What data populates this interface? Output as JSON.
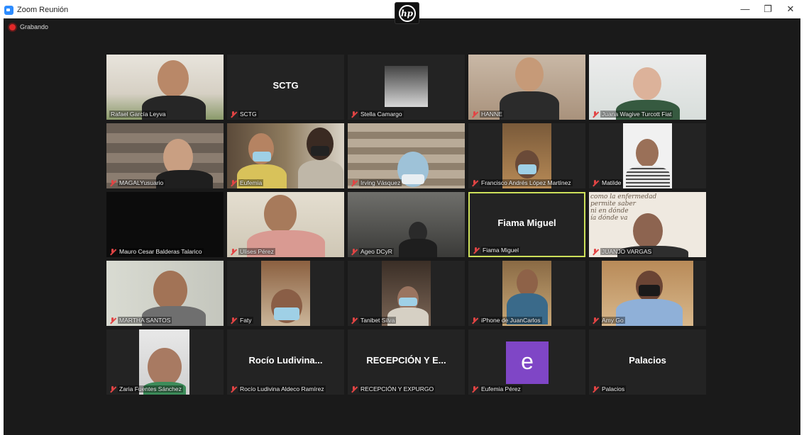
{
  "window": {
    "title": "Zoom Reunión",
    "controls": {
      "minimize": "—",
      "maximize": "❐",
      "close": "✕"
    }
  },
  "meeting": {
    "recording_label": "Grabando",
    "colors": {
      "background": "#1a1a1a",
      "tile": "#232323",
      "active_border": "#cde05a",
      "muted_mic": "#e24444",
      "avatar_purple": "#7f46c6"
    }
  },
  "participants": [
    {
      "name": "Rafael García Leyva",
      "center": ""
    },
    {
      "name": "SCTG",
      "center": "SCTG"
    },
    {
      "name": "Stella Camargo",
      "center": ""
    },
    {
      "name": "HANNE",
      "center": ""
    },
    {
      "name": "Juana Wagive Turcott Fiat",
      "center": ""
    },
    {
      "name": "MAGALYusuario",
      "center": ""
    },
    {
      "name": "Eufemia",
      "center": ""
    },
    {
      "name": "Irving Vásquez",
      "center": ""
    },
    {
      "name": "Francisco Andrés López Martínez",
      "center": ""
    },
    {
      "name": "Matilde",
      "center": ""
    },
    {
      "name": "Mauro Cesar Balderas Talarico",
      "center": ""
    },
    {
      "name": "Ulises Pérez",
      "center": ""
    },
    {
      "name": "Ageo DCyR",
      "center": ""
    },
    {
      "name": "Fiama Miguel",
      "center": "Fiama Miguel"
    },
    {
      "name": "JUANJO VARGAS",
      "center": ""
    },
    {
      "name": "MARTHA SANTOS",
      "center": ""
    },
    {
      "name": "Faty",
      "center": ""
    },
    {
      "name": "Tanibet Silva",
      "center": ""
    },
    {
      "name": "iPhone de JuanCarlos",
      "center": ""
    },
    {
      "name": "Amy Go",
      "center": ""
    },
    {
      "name": "Zaria Fuentes Sánchez",
      "center": ""
    },
    {
      "name": "Rocío Ludivina Aldeco Ramírez",
      "center": "Rocío Ludivina..."
    },
    {
      "name": "RECEPCIÓN Y EXPURGO",
      "center": "RECEPCIÓN Y E..."
    },
    {
      "name": "Eufemia Pérez",
      "center": "",
      "avatar_letter": "e"
    },
    {
      "name": "Palacios",
      "center": "Palacios"
    }
  ],
  "tile_text": {
    "juanjo_background": "como la enfermedad\npermite saber\nni en dónde\nía dónde va"
  }
}
